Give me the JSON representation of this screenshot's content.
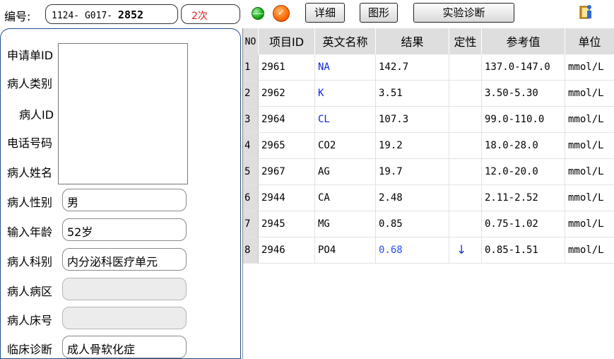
{
  "header": {
    "number_label": "编号:",
    "number_prefix": "1124-  G017-",
    "number_suffix": "2852",
    "count": "2次",
    "btn_detail": "详细",
    "btn_graph": "图形",
    "btn_diagnosis": "实验诊断",
    "orange_icon_glyph": "✓"
  },
  "patient": {
    "labels": {
      "request_id": "申请单ID",
      "category": "病人类别",
      "patient_id": "病人ID",
      "phone": "电话号码",
      "name": "病人姓名",
      "gender": "病人性别",
      "age": "输入年龄",
      "department": "病人科别",
      "ward": "病人病区",
      "bed": "病人床号",
      "diagnosis": "临床诊断"
    },
    "gender": "男",
    "age": "52岁",
    "department": "内分泌科医疗单元",
    "ward": "",
    "bed": "",
    "diagnosis": "成人骨软化症"
  },
  "table": {
    "headers": {
      "no": "NO",
      "item_id": "项目ID",
      "name_en": "英文名称",
      "result": "结果",
      "qual": "定性",
      "ref": "参考值",
      "unit": "单位"
    },
    "rows": [
      {
        "no": "1",
        "id": "2961",
        "name": "NA",
        "result": "142.7",
        "qual": "",
        "ref": "137.0-147.0",
        "unit": "mmol/L"
      },
      {
        "no": "2",
        "id": "2962",
        "name": "K",
        "result": "3.51",
        "qual": "",
        "ref": "3.50-5.30",
        "unit": "mmol/L"
      },
      {
        "no": "3",
        "id": "2964",
        "name": "CL",
        "result": "107.3",
        "qual": "",
        "ref": "99.0-110.0",
        "unit": "mmol/L"
      },
      {
        "no": "4",
        "id": "2965",
        "name": "CO2",
        "result": "19.2",
        "qual": "",
        "ref": "18.0-28.0",
        "unit": "mmol/L"
      },
      {
        "no": "5",
        "id": "2967",
        "name": "AG",
        "result": "19.7",
        "qual": "",
        "ref": "12.0-20.0",
        "unit": "mmol/L"
      },
      {
        "no": "6",
        "id": "2944",
        "name": "CA",
        "result": "2.48",
        "qual": "",
        "ref": "2.11-2.52",
        "unit": "mmol/L"
      },
      {
        "no": "7",
        "id": "2945",
        "name": "MG",
        "result": "0.85",
        "qual": "",
        "ref": "0.75-1.02",
        "unit": "mmol/L"
      },
      {
        "no": "8",
        "id": "2946",
        "name": "PO4",
        "result": "0.68",
        "qual": "↓",
        "ref": "0.85-1.51",
        "unit": "mmol/L"
      }
    ]
  },
  "colors": {
    "blue_name": "#0a2ad8",
    "low_result": "#2a4ef5",
    "count_red": "#e02020"
  }
}
